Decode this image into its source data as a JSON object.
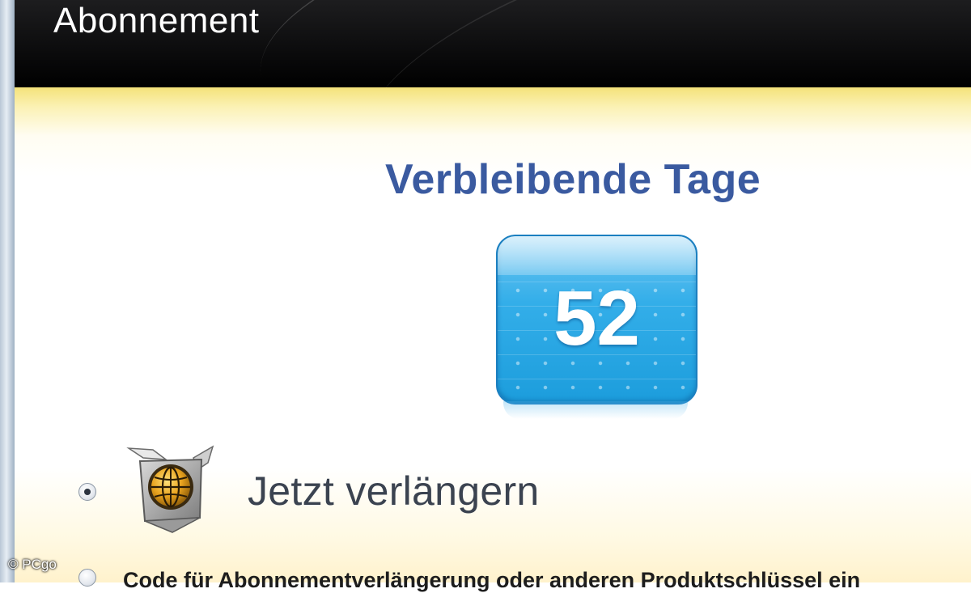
{
  "header": {
    "title": "Abonnement"
  },
  "subscription": {
    "heading": "Verbleibende Tage",
    "days_remaining": "52",
    "tile_color": "#2aa8e6"
  },
  "options": [
    {
      "label": "Jetzt verlängern",
      "selected": true,
      "icon": "globe-box-icon"
    },
    {
      "label": "Code für Abonnementverlängerung oder anderen Produktschlüssel ein",
      "selected": false
    }
  ],
  "watermark": "© PCgo"
}
